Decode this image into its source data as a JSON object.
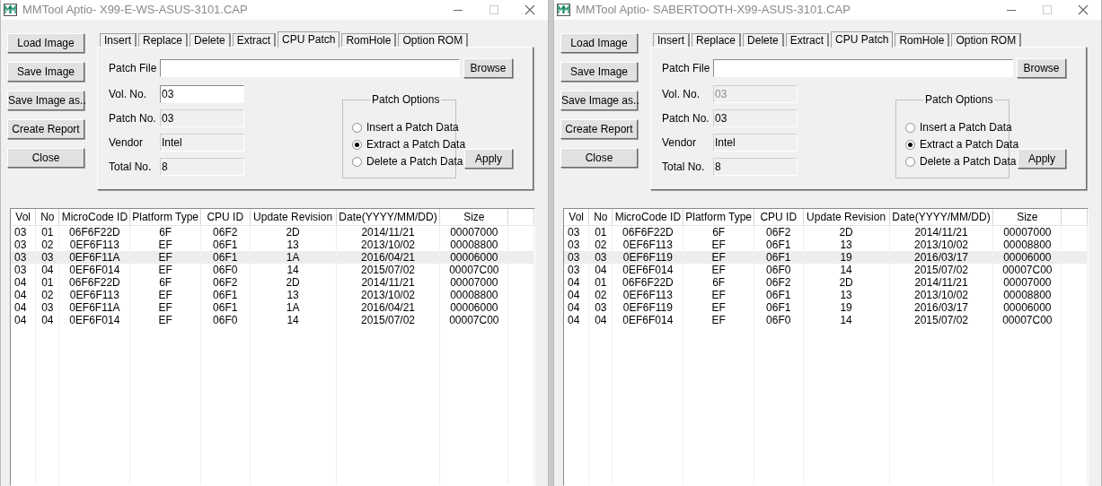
{
  "windows": [
    {
      "title": "MMTool Aptio- X99-E-WS-ASUS-3101.CAP",
      "buttons": [
        "Load Image",
        "Save Image",
        "Save Image as..",
        "Create Report",
        "Close"
      ],
      "tabs": [
        {
          "label": "Insert",
          "selected": false
        },
        {
          "label": "Replace",
          "selected": false
        },
        {
          "label": "Delete",
          "selected": false
        },
        {
          "label": "Extract",
          "selected": false
        },
        {
          "label": "CPU Patch",
          "selected": true
        },
        {
          "label": "RomHole",
          "selected": false
        },
        {
          "label": "Option ROM",
          "selected": false
        }
      ],
      "patch_file": {
        "label": "Patch File",
        "browse": "Browse"
      },
      "fields": [
        {
          "label": "Vol. No.",
          "value": "03",
          "readonly": false,
          "disabled": false
        },
        {
          "label": "Patch No.",
          "value": "03",
          "readonly": true,
          "disabled": false
        },
        {
          "label": "Vendor",
          "value": "Intel",
          "readonly": true,
          "disabled": false
        },
        {
          "label": "Total No.",
          "value": "8",
          "readonly": true,
          "disabled": false
        }
      ],
      "patch_options": {
        "title": "Patch Options",
        "options": [
          {
            "label": "Insert a Patch Data",
            "selected": false
          },
          {
            "label": "Extract a Patch Data",
            "selected": true
          },
          {
            "label": "Delete a Patch Data",
            "selected": false
          }
        ]
      },
      "apply": "Apply",
      "table": {
        "columns": [
          "Vol",
          "No",
          "MicroCode ID",
          "Platform Type",
          "CPU ID",
          "Update Revision",
          "Date(YYYY/MM/DD)",
          "Size"
        ],
        "rows": [
          {
            "cells": [
              "03",
              "01",
              "06F6F22D",
              "6F",
              "06F2",
              "2D",
              "2014/11/21",
              "00007000"
            ],
            "selected": false
          },
          {
            "cells": [
              "03",
              "02",
              "0EF6F113",
              "EF",
              "06F1",
              "13",
              "2013/10/02",
              "00008800"
            ],
            "selected": false
          },
          {
            "cells": [
              "03",
              "03",
              "0EF6F11A",
              "EF",
              "06F1",
              "1A",
              "2016/04/21",
              "00006000"
            ],
            "selected": true
          },
          {
            "cells": [
              "03",
              "04",
              "0EF6F014",
              "EF",
              "06F0",
              "14",
              "2015/07/02",
              "00007C00"
            ],
            "selected": false
          },
          {
            "cells": [
              "04",
              "01",
              "06F6F22D",
              "6F",
              "06F2",
              "2D",
              "2014/11/21",
              "00007000"
            ],
            "selected": false
          },
          {
            "cells": [
              "04",
              "02",
              "0EF6F113",
              "EF",
              "06F1",
              "13",
              "2013/10/02",
              "00008800"
            ],
            "selected": false
          },
          {
            "cells": [
              "04",
              "03",
              "0EF6F11A",
              "EF",
              "06F1",
              "1A",
              "2016/04/21",
              "00006000"
            ],
            "selected": false
          },
          {
            "cells": [
              "04",
              "04",
              "0EF6F014",
              "EF",
              "06F0",
              "14",
              "2015/07/02",
              "00007C00"
            ],
            "selected": false
          }
        ]
      }
    },
    {
      "title": "MMTool Aptio- SABERTOOTH-X99-ASUS-3101.CAP",
      "buttons": [
        "Load Image",
        "Save Image",
        "Save Image as..",
        "Create Report",
        "Close"
      ],
      "tabs": [
        {
          "label": "Insert",
          "selected": false
        },
        {
          "label": "Replace",
          "selected": false
        },
        {
          "label": "Delete",
          "selected": false
        },
        {
          "label": "Extract",
          "selected": false
        },
        {
          "label": "CPU Patch",
          "selected": true
        },
        {
          "label": "RomHole",
          "selected": false
        },
        {
          "label": "Option ROM",
          "selected": false
        }
      ],
      "patch_file": {
        "label": "Patch File",
        "browse": "Browse"
      },
      "fields": [
        {
          "label": "Vol. No.",
          "value": "03",
          "readonly": false,
          "disabled": true
        },
        {
          "label": "Patch No.",
          "value": "03",
          "readonly": true,
          "disabled": false
        },
        {
          "label": "Vendor",
          "value": "Intel",
          "readonly": true,
          "disabled": false
        },
        {
          "label": "Total No.",
          "value": "8",
          "readonly": true,
          "disabled": false
        }
      ],
      "patch_options": {
        "title": "Patch Options",
        "options": [
          {
            "label": "Insert a Patch Data",
            "selected": false
          },
          {
            "label": "Extract a Patch Data",
            "selected": true
          },
          {
            "label": "Delete a Patch Data",
            "selected": false
          }
        ]
      },
      "apply": "Apply",
      "table": {
        "columns": [
          "Vol",
          "No",
          "MicroCode ID",
          "Platform Type",
          "CPU ID",
          "Update Revision",
          "Date(YYYY/MM/DD)",
          "Size"
        ],
        "rows": [
          {
            "cells": [
              "03",
              "01",
              "06F6F22D",
              "6F",
              "06F2",
              "2D",
              "2014/11/21",
              "00007000"
            ],
            "selected": false
          },
          {
            "cells": [
              "03",
              "02",
              "0EF6F113",
              "EF",
              "06F1",
              "13",
              "2013/10/02",
              "00008800"
            ],
            "selected": false
          },
          {
            "cells": [
              "03",
              "03",
              "0EF6F119",
              "EF",
              "06F1",
              "19",
              "2016/03/17",
              "00006000"
            ],
            "selected": true
          },
          {
            "cells": [
              "03",
              "04",
              "0EF6F014",
              "EF",
              "06F0",
              "14",
              "2015/07/02",
              "00007C00"
            ],
            "selected": false
          },
          {
            "cells": [
              "04",
              "01",
              "06F6F22D",
              "6F",
              "06F2",
              "2D",
              "2014/11/21",
              "00007000"
            ],
            "selected": false
          },
          {
            "cells": [
              "04",
              "02",
              "0EF6F113",
              "EF",
              "06F1",
              "13",
              "2013/10/02",
              "00008800"
            ],
            "selected": false
          },
          {
            "cells": [
              "04",
              "03",
              "0EF6F119",
              "EF",
              "06F1",
              "19",
              "2016/03/17",
              "00006000"
            ],
            "selected": false
          },
          {
            "cells": [
              "04",
              "04",
              "0EF6F014",
              "EF",
              "06F0",
              "14",
              "2015/07/02",
              "00007C00"
            ],
            "selected": false
          }
        ]
      }
    }
  ]
}
